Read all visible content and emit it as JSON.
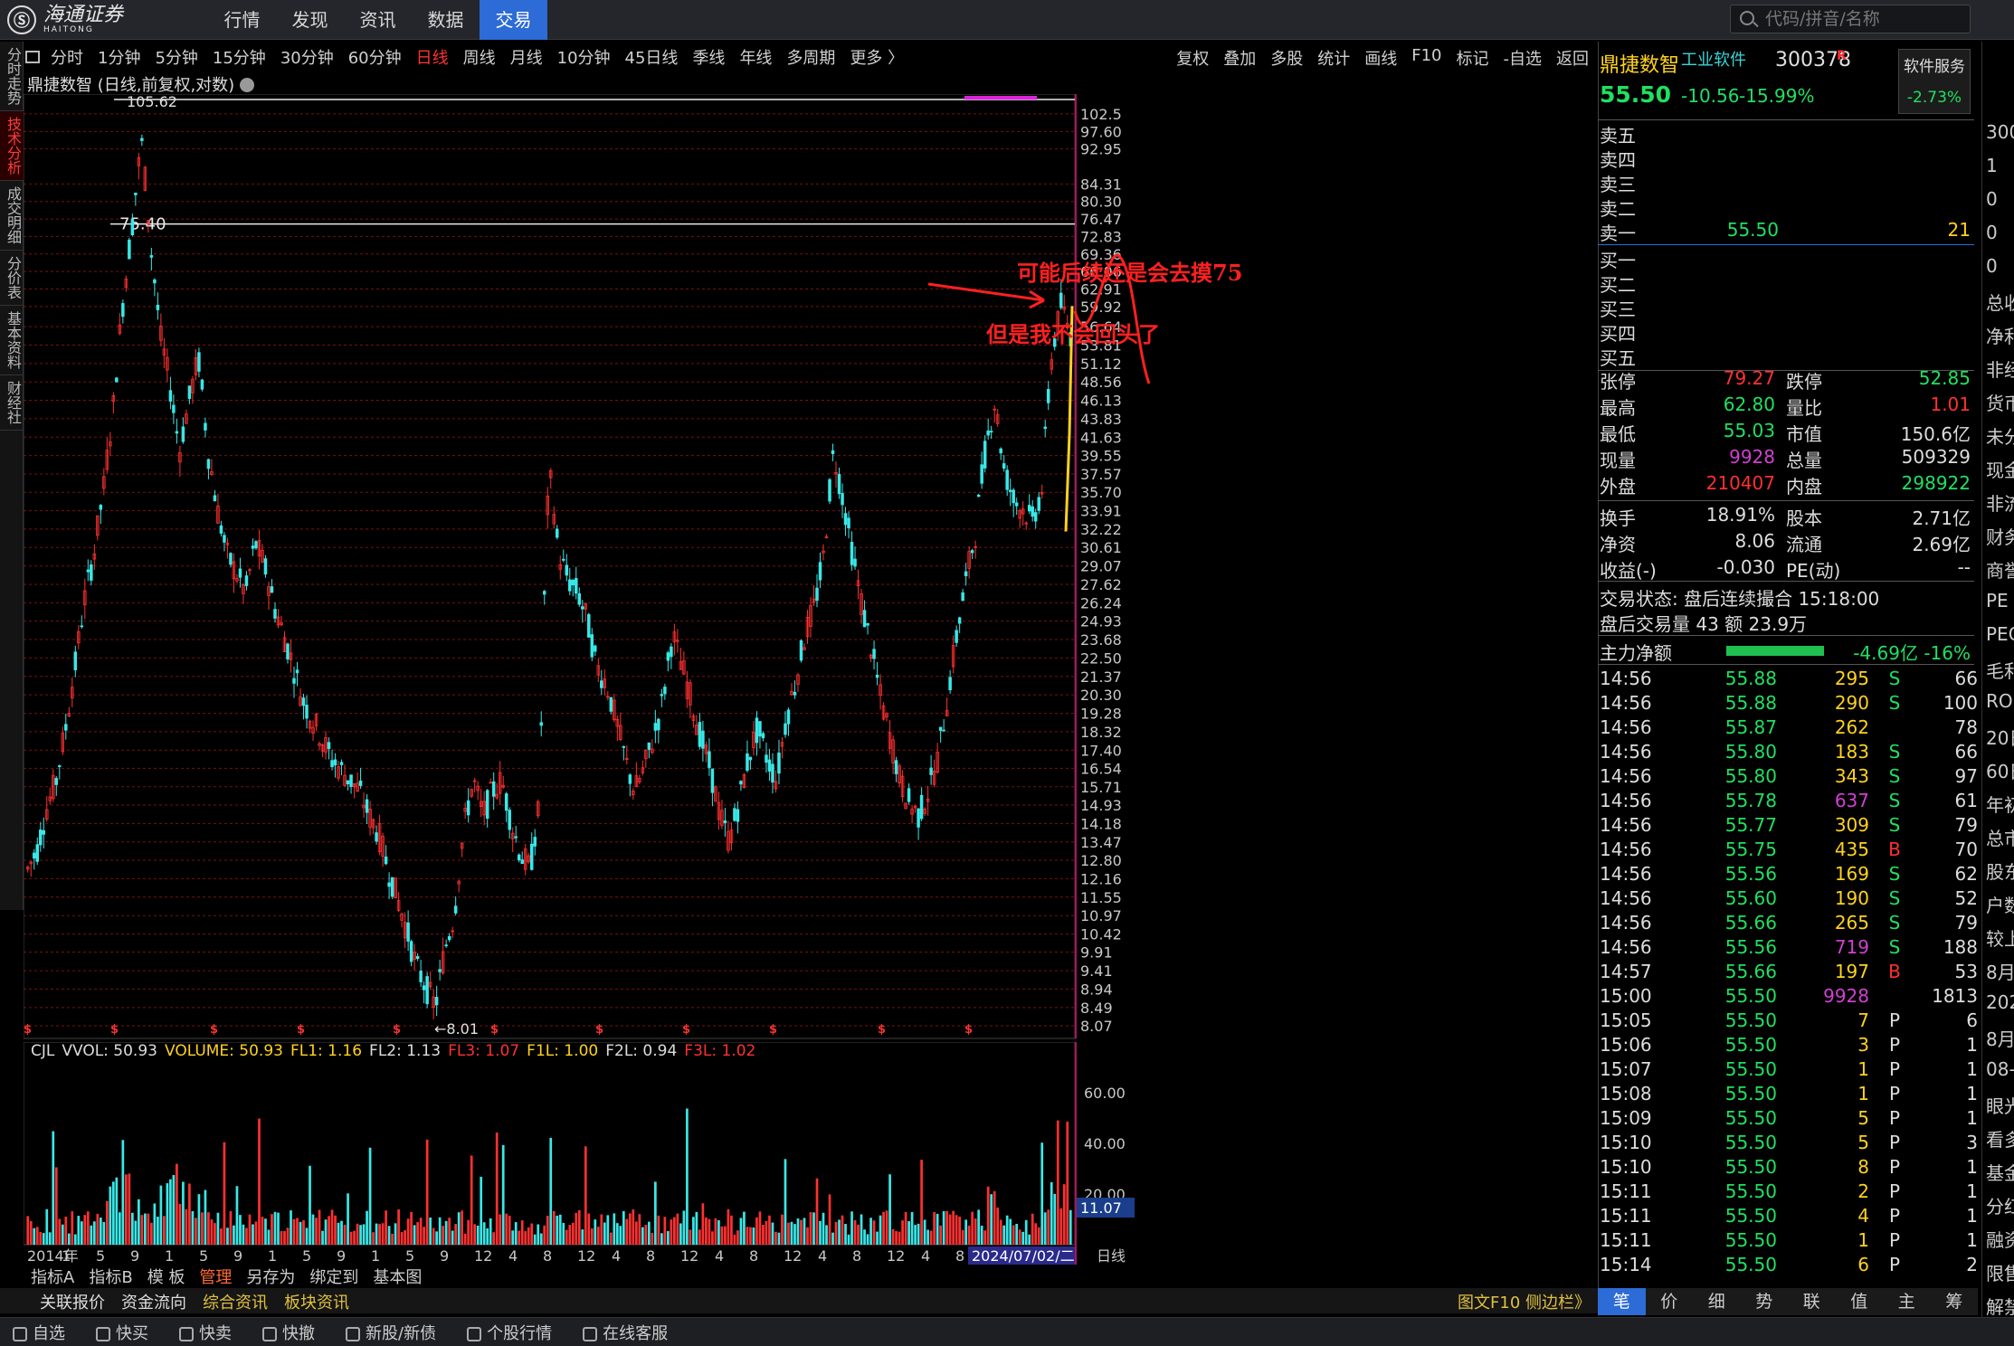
{
  "brand": {
    "name": "海通证券",
    "sub": "HAITONG"
  },
  "main_menu": [
    "行情",
    "发现",
    "资讯",
    "数据",
    "交易"
  ],
  "main_menu_active": 4,
  "search": {
    "placeholder": "代码/拼音/名称"
  },
  "left_tabs": [
    "分时走势",
    "技术分析",
    "成交明细",
    "分价表",
    "基本资料",
    "财经社"
  ],
  "chart_toolbar": {
    "periods": [
      "分时",
      "1分钟",
      "5分钟",
      "15分钟",
      "30分钟",
      "60分钟",
      "日线",
      "周线",
      "月线",
      "10分钟",
      "45日线",
      "季线",
      "年线",
      "多周期",
      "更多 〉"
    ],
    "active": "日线",
    "tools": [
      "复权",
      "叠加",
      "多股",
      "统计",
      "画线",
      "F10",
      "标记",
      "-自选",
      "返回"
    ]
  },
  "chart_title": "鼎捷数智 (日线,前复权,对数)",
  "annotations": {
    "line1": "可能后续还是会去摸75",
    "line2": "但是我不会回头了"
  },
  "chart_data": {
    "type": "candlestick",
    "y_axis_ticks": [
      "102.5",
      "97.60",
      "92.95",
      "84.31",
      "80.30",
      "76.47",
      "72.83",
      "69.36",
      "66.06",
      "62.91",
      "59.92",
      "56.64",
      "53.81",
      "51.12",
      "48.56",
      "46.13",
      "43.83",
      "41.63",
      "39.55",
      "37.57",
      "35.70",
      "33.91",
      "32.22",
      "30.61",
      "29.07",
      "27.62",
      "26.24",
      "24.93",
      "23.68",
      "22.50",
      "21.37",
      "20.30",
      "19.28",
      "18.32",
      "17.40",
      "16.54",
      "15.71",
      "14.93",
      "14.18",
      "13.47",
      "12.80",
      "12.16",
      "11.55",
      "10.97",
      "10.42",
      "9.91",
      "9.41",
      "8.94",
      "8.49",
      "8.07"
    ],
    "ylim": [
      8.07,
      105.62
    ],
    "price_high_label": "105.62",
    "price_low_label": "8.01",
    "horizontal_line": "75.40",
    "x_axis_labels": [
      "2014年",
      "1",
      "5",
      "9",
      "1",
      "5",
      "9",
      "1",
      "5",
      "9",
      "1",
      "5",
      "9",
      "12",
      "4",
      "8",
      "12",
      "4",
      "8",
      "12",
      "4",
      "8",
      "12",
      "4",
      "8",
      "12",
      "4",
      "8",
      "12",
      "4"
    ],
    "cursor_date": "2024/07/02/二",
    "period_label": "日线",
    "series_close": [
      12.5,
      13.2,
      14.8,
      16.0,
      18.5,
      22.0,
      26.5,
      30.2,
      36.0,
      45.0,
      60.0,
      75.0,
      95.0,
      70.0,
      55.0,
      48.0,
      40.0,
      46.0,
      52.0,
      40.0,
      34.0,
      30.0,
      28.5,
      27.0,
      31.0,
      29.0,
      26.0,
      24.0,
      22.0,
      20.0,
      19.0,
      18.0,
      17.0,
      16.5,
      16.0,
      15.5,
      14.5,
      13.8,
      12.5,
      11.5,
      10.5,
      9.5,
      9.0,
      8.5,
      10.0,
      11.0,
      14.0,
      16.0,
      14.5,
      15.5,
      16.0,
      14.2,
      13.0,
      12.5,
      15.0,
      38.0,
      30.0,
      28.0,
      27.0,
      25.0,
      22.0,
      21.0,
      19.0,
      17.0,
      15.5,
      16.5,
      18.0,
      20.0,
      24.0,
      22.0,
      20.0,
      18.0,
      16.5,
      14.5,
      13.5,
      15.0,
      17.0,
      18.5,
      17.0,
      16.0,
      19.0,
      21.0,
      24.0,
      26.0,
      30.0,
      40.0,
      35.0,
      30.0,
      26.0,
      23.0,
      20.0,
      18.0,
      16.0,
      15.0,
      14.5,
      15.5,
      17.0,
      20.0,
      24.0,
      28.0,
      32.0,
      40.0,
      46.0,
      38.0,
      35.0,
      34.0,
      33.0,
      36.0,
      52.0,
      60.0,
      55.5
    ],
    "volume_label": "VVOL: 50.93",
    "volume_ticks": [
      "60.00",
      "40.00",
      "20.00"
    ],
    "volume_current": "11.07",
    "indicators": [
      {
        "name": "CJL",
        "color": "#dddddd"
      },
      {
        "name": "VVOL: 50.93",
        "color": "#dddddd"
      },
      {
        "name": "VOLUME: 50.93",
        "color": "#ffd21e"
      },
      {
        "name": "FL1: 1.16",
        "color": "#ffd21e"
      },
      {
        "name": "FL2: 1.13",
        "color": "#dddddd"
      },
      {
        "name": "FL3: 1.07",
        "color": "#ff3030"
      },
      {
        "name": "F1L: 1.00",
        "color": "#ffd21e"
      },
      {
        "name": "F2L: 0.94",
        "color": "#dddddd"
      },
      {
        "name": "F3L: 1.02",
        "color": "#ff3030"
      }
    ]
  },
  "stock": {
    "name": "鼎捷数智",
    "industry": "工业软件",
    "code": "300378",
    "flag": "R",
    "price": "55.50",
    "change": "-10.56",
    "change_pct": "-15.99%",
    "service_label": "软件服务",
    "service_pct": "-2.73%"
  },
  "order_book": {
    "sells": [
      {
        "label": "卖五",
        "price": "",
        "qty": ""
      },
      {
        "label": "卖四",
        "price": "",
        "qty": ""
      },
      {
        "label": "卖三",
        "price": "",
        "qty": ""
      },
      {
        "label": "卖二",
        "price": "",
        "qty": ""
      },
      {
        "label": "卖一",
        "price": "55.50",
        "qty": "21"
      }
    ],
    "buys": [
      {
        "label": "买一",
        "price": "",
        "qty": ""
      },
      {
        "label": "买二",
        "price": "",
        "qty": ""
      },
      {
        "label": "买三",
        "price": "",
        "qty": ""
      },
      {
        "label": "买四",
        "price": "",
        "qty": ""
      },
      {
        "label": "买五",
        "price": "",
        "qty": ""
      }
    ]
  },
  "info": [
    {
      "l1": "张停",
      "v1": "79.27",
      "c1": "#ff3030",
      "l2": "跌停",
      "v2": "52.85",
      "c2": "#20e060"
    },
    {
      "l1": "最高",
      "v1": "62.80",
      "c1": "#20e060",
      "l2": "量比",
      "v2": "1.01",
      "c2": "#ff3030"
    },
    {
      "l1": "最低",
      "v1": "55.03",
      "c1": "#20e060",
      "l2": "市值",
      "v2": "150.6亿",
      "c2": "#dddddd"
    },
    {
      "l1": "现量",
      "v1": "9928",
      "c1": "#d040d0",
      "l2": "总量",
      "v2": "509329",
      "c2": "#dddddd"
    },
    {
      "l1": "外盘",
      "v1": "210407",
      "c1": "#ff3030",
      "l2": "内盘",
      "v2": "298922",
      "c2": "#20e060"
    },
    {
      "l1": "换手",
      "v1": "18.91%",
      "c1": "#dddddd",
      "l2": "股本",
      "v2": "2.71亿",
      "c2": "#dddddd"
    },
    {
      "l1": "净资",
      "v1": "8.06",
      "c1": "#dddddd",
      "l2": "流通",
      "v2": "2.69亿",
      "c2": "#dddddd"
    },
    {
      "l1": "收益(-)",
      "v1": "-0.030",
      "c1": "#dddddd",
      "l2": "PE(动)",
      "v2": "--",
      "c2": "#dddddd"
    }
  ],
  "trade_state": "交易状态: 盘后连续撮合 15:18:00",
  "after_hours": "盘后交易量 43 额 23.9万",
  "main_net": {
    "label": "主力净额",
    "value": "-4.69亿 -16%"
  },
  "ticks": [
    {
      "t": "14:56",
      "p": "55.88",
      "v": "295",
      "vc": "#ffd21e",
      "f": "S",
      "n": "66"
    },
    {
      "t": "14:56",
      "p": "55.88",
      "v": "290",
      "vc": "#ffd21e",
      "f": "S",
      "n": "100"
    },
    {
      "t": "14:56",
      "p": "55.87",
      "v": "262",
      "vc": "#ffd21e",
      "f": "",
      "n": "78"
    },
    {
      "t": "14:56",
      "p": "55.80",
      "v": "183",
      "vc": "#ffd21e",
      "f": "S",
      "n": "66"
    },
    {
      "t": "14:56",
      "p": "55.80",
      "v": "343",
      "vc": "#ffd21e",
      "f": "S",
      "n": "97"
    },
    {
      "t": "14:56",
      "p": "55.78",
      "v": "637",
      "vc": "#d040d0",
      "f": "S",
      "n": "61"
    },
    {
      "t": "14:56",
      "p": "55.77",
      "v": "309",
      "vc": "#ffd21e",
      "f": "S",
      "n": "79"
    },
    {
      "t": "14:56",
      "p": "55.75",
      "v": "435",
      "vc": "#ffd21e",
      "f": "B",
      "n": "70"
    },
    {
      "t": "14:56",
      "p": "55.56",
      "v": "169",
      "vc": "#ffd21e",
      "f": "S",
      "n": "62"
    },
    {
      "t": "14:56",
      "p": "55.60",
      "v": "190",
      "vc": "#ffd21e",
      "f": "S",
      "n": "52"
    },
    {
      "t": "14:56",
      "p": "55.66",
      "v": "265",
      "vc": "#ffd21e",
      "f": "S",
      "n": "79"
    },
    {
      "t": "14:56",
      "p": "55.56",
      "v": "719",
      "vc": "#d040d0",
      "f": "S",
      "n": "188"
    },
    {
      "t": "14:57",
      "p": "55.66",
      "v": "197",
      "vc": "#ffd21e",
      "f": "B",
      "n": "53"
    },
    {
      "t": "15:00",
      "p": "55.50",
      "v": "9928",
      "vc": "#d040d0",
      "f": "",
      "n": "1813"
    },
    {
      "t": "15:05",
      "p": "55.50",
      "v": "7",
      "vc": "#ffd21e",
      "f": "P",
      "n": "6"
    },
    {
      "t": "15:06",
      "p": "55.50",
      "v": "3",
      "vc": "#ffd21e",
      "f": "P",
      "n": "1"
    },
    {
      "t": "15:07",
      "p": "55.50",
      "v": "1",
      "vc": "#ffd21e",
      "f": "P",
      "n": "1"
    },
    {
      "t": "15:08",
      "p": "55.50",
      "v": "1",
      "vc": "#ffd21e",
      "f": "P",
      "n": "1"
    },
    {
      "t": "15:09",
      "p": "55.50",
      "v": "5",
      "vc": "#ffd21e",
      "f": "P",
      "n": "1"
    },
    {
      "t": "15:10",
      "p": "55.50",
      "v": "5",
      "vc": "#ffd21e",
      "f": "P",
      "n": "3"
    },
    {
      "t": "15:10",
      "p": "55.50",
      "v": "8",
      "vc": "#ffd21e",
      "f": "P",
      "n": "1"
    },
    {
      "t": "15:11",
      "p": "55.50",
      "v": "2",
      "vc": "#ffd21e",
      "f": "P",
      "n": "1"
    },
    {
      "t": "15:11",
      "p": "55.50",
      "v": "4",
      "vc": "#ffd21e",
      "f": "P",
      "n": "1"
    },
    {
      "t": "15:11",
      "p": "55.50",
      "v": "1",
      "vc": "#ffd21e",
      "f": "P",
      "n": "1"
    },
    {
      "t": "15:14",
      "p": "55.50",
      "v": "6",
      "vc": "#ffd21e",
      "f": "P",
      "n": "2"
    }
  ],
  "right_tabs": [
    "笔",
    "价",
    "细",
    "势",
    "联",
    "值",
    "主",
    "筹"
  ],
  "right_tabs_active": 0,
  "far_right": [
    "300",
    "1",
    "0",
    "0",
    "0",
    "总收",
    "净利",
    "非经",
    "货币",
    "未分",
    "现金",
    "非流",
    "财务",
    "商誉",
    "PE",
    "PEG",
    "毛利",
    "ROE",
    "20日",
    "60日",
    "年初",
    "总市",
    "股东",
    "户数",
    "较上",
    "8月",
    "202",
    "8月",
    "08-",
    "眼光",
    "看多",
    "基金",
    "分红",
    "融资",
    "限售",
    "解禁"
  ],
  "bottom_tabs": [
    "指标A",
    "指标B",
    "模 板",
    "管理",
    "另存为",
    "绑定到",
    "基本图"
  ],
  "bottom_tabs_active": 3,
  "bottom_tabs2": [
    "关联报价",
    "资金流向",
    "综合资讯",
    "板块资讯"
  ],
  "bottom_tabs2_right": "图文F10 侧边栏》",
  "status_items": [
    "自选",
    "快买",
    "快卖",
    "快撤",
    "新股/新债",
    "个股行情",
    "在线客服"
  ]
}
